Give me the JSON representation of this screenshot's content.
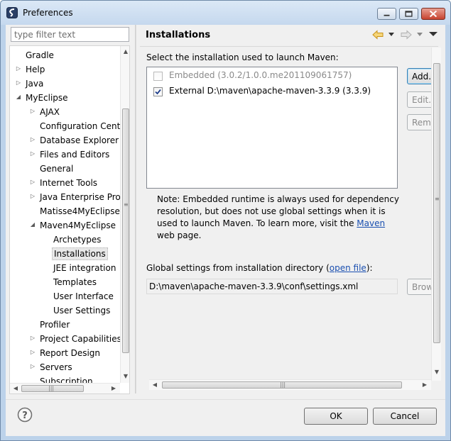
{
  "window": {
    "title": "Preferences",
    "icons": {
      "app": "myeclipse-logo-icon",
      "minimize": "minimize-icon",
      "maximize": "maximize-icon",
      "close": "close-icon"
    }
  },
  "sidebar": {
    "filter_placeholder": "type filter text",
    "filter_value": "",
    "tree": [
      {
        "label": "Gradle",
        "depth": 1,
        "toggle": "none"
      },
      {
        "label": "Help",
        "depth": 1,
        "toggle": "collapsed"
      },
      {
        "label": "Java",
        "depth": 1,
        "toggle": "collapsed"
      },
      {
        "label": "MyEclipse",
        "depth": 1,
        "toggle": "expanded"
      },
      {
        "label": "AJAX",
        "depth": 2,
        "toggle": "collapsed"
      },
      {
        "label": "Configuration Center",
        "depth": 2,
        "toggle": "none"
      },
      {
        "label": "Database Explorer",
        "depth": 2,
        "toggle": "collapsed"
      },
      {
        "label": "Files and Editors",
        "depth": 2,
        "toggle": "collapsed"
      },
      {
        "label": "General",
        "depth": 2,
        "toggle": "none"
      },
      {
        "label": "Internet Tools",
        "depth": 2,
        "toggle": "collapsed"
      },
      {
        "label": "Java Enterprise Project",
        "depth": 2,
        "toggle": "collapsed"
      },
      {
        "label": "Matisse4MyEclipse",
        "depth": 2,
        "toggle": "none"
      },
      {
        "label": "Maven4MyEclipse",
        "depth": 2,
        "toggle": "expanded"
      },
      {
        "label": "Archetypes",
        "depth": 3,
        "toggle": "none"
      },
      {
        "label": "Installations",
        "depth": 3,
        "toggle": "none",
        "selected": true
      },
      {
        "label": "JEE integration",
        "depth": 3,
        "toggle": "none"
      },
      {
        "label": "Templates",
        "depth": 3,
        "toggle": "none"
      },
      {
        "label": "User Interface",
        "depth": 3,
        "toggle": "none"
      },
      {
        "label": "User Settings",
        "depth": 3,
        "toggle": "none"
      },
      {
        "label": "Profiler",
        "depth": 2,
        "toggle": "none"
      },
      {
        "label": "Project Capabilities",
        "depth": 2,
        "toggle": "collapsed"
      },
      {
        "label": "Report Design",
        "depth": 2,
        "toggle": "collapsed"
      },
      {
        "label": "Servers",
        "depth": 2,
        "toggle": "collapsed"
      },
      {
        "label": "Subscription",
        "depth": 2,
        "toggle": "none"
      }
    ]
  },
  "page": {
    "title": "Installations",
    "nav_icons": {
      "back": "back-arrow-icon",
      "forward": "forward-arrow-icon",
      "menu": "view-menu-icon"
    },
    "select_label": "Select the installation used to launch Maven:",
    "installations": [
      {
        "label": "Embedded (3.0.2/1.0.0.me201109061757)",
        "checked": false,
        "disabled": true
      },
      {
        "label": "External D:\\maven\\apache-maven-3.3.9 (3.3.9)",
        "checked": true,
        "disabled": false
      }
    ],
    "buttons": {
      "add": "Add...",
      "edit": "Edit...",
      "remove": "Remove",
      "browse": "Browse..."
    },
    "note": {
      "before_link": "Note: Embedded runtime is always used for dependency resolution, but does not use global settings when it is used to launch Maven. To learn more, visit the ",
      "link": "Maven",
      "after_link": " web page."
    },
    "global_settings": {
      "label_before": "Global settings from installation directory (",
      "link": "open file",
      "label_after": "):",
      "value": "D:\\maven\\apache-maven-3.3.9\\conf\\settings.xml"
    }
  },
  "footer": {
    "help_icon": "help-question-icon",
    "ok_label": "OK",
    "cancel_label": "Cancel"
  },
  "colors": {
    "link": "#1a4fb0",
    "title_bar": "#c5d8ee",
    "close_button": "#c7432f"
  }
}
